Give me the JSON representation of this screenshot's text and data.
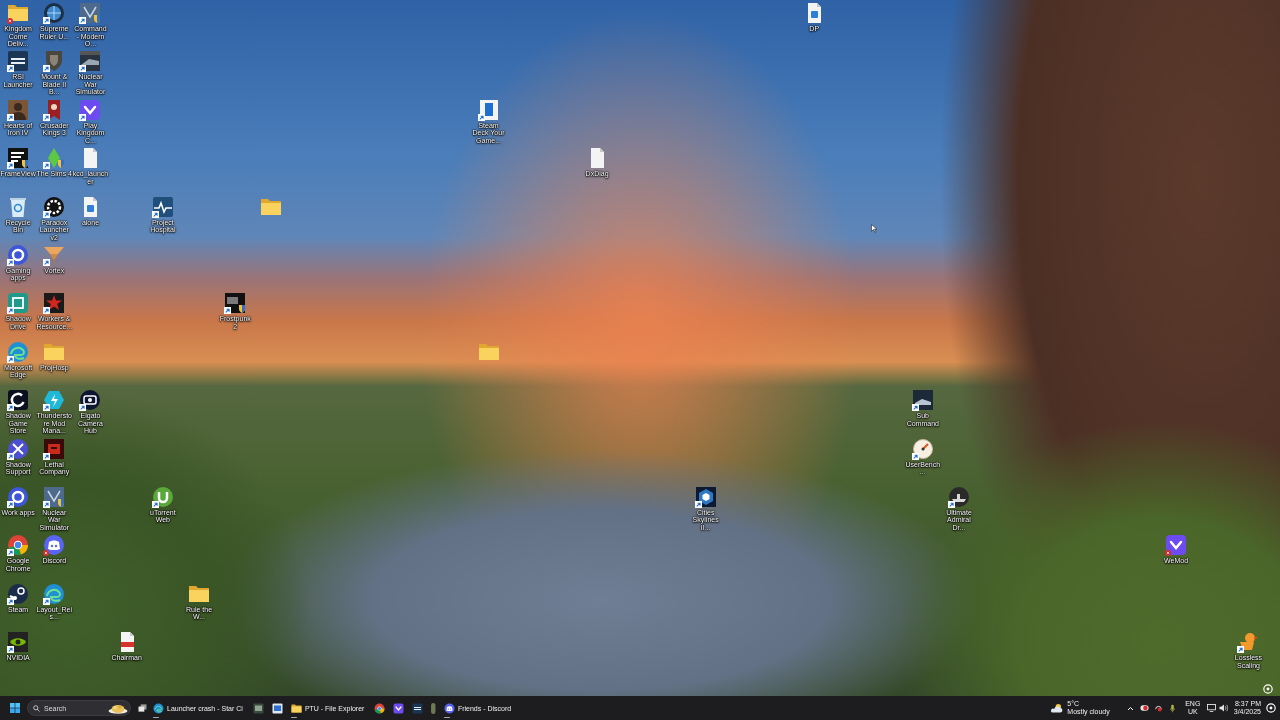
{
  "desktop": {
    "icons": [
      {
        "label": "Kingdom Come Deliv...",
        "shortcut": false,
        "alert": true
      },
      {
        "label": "RSI Launcher",
        "shortcut": true,
        "alert": false
      },
      {
        "label": "Hearts of Iron IV",
        "shortcut": true,
        "alert": false
      },
      {
        "label": "FrameView",
        "shortcut": true,
        "alert": false
      },
      {
        "label": "Recycle Bin",
        "shortcut": false,
        "alert": false
      },
      {
        "label": "Gaming apps",
        "shortcut": true,
        "alert": false
      },
      {
        "label": "Shadow Drive",
        "shortcut": true,
        "alert": false
      },
      {
        "label": "Microsoft Edge",
        "shortcut": true,
        "alert": false
      },
      {
        "label": "Shadow Game Store",
        "shortcut": true,
        "alert": false
      },
      {
        "label": "Shadow Support",
        "shortcut": true,
        "alert": false
      },
      {
        "label": "Work apps",
        "shortcut": true,
        "alert": false
      },
      {
        "label": "Google Chrome",
        "shortcut": true,
        "alert": false
      },
      {
        "label": "Steam",
        "shortcut": true,
        "alert": false
      },
      {
        "label": "NVIDIA",
        "shortcut": true,
        "alert": false
      },
      {
        "label": "Supreme Ruler U...",
        "shortcut": true,
        "alert": false
      },
      {
        "label": "Mount & Blade II B...",
        "shortcut": true,
        "alert": false
      },
      {
        "label": "Crusader Kings 3",
        "shortcut": true,
        "alert": false
      },
      {
        "label": "The Sims 4",
        "shortcut": true,
        "alert": false
      },
      {
        "label": "Paradox Launcher v2",
        "shortcut": true,
        "alert": false
      },
      {
        "label": "Vortex",
        "shortcut": true,
        "alert": false
      },
      {
        "label": "Workers & Resource...",
        "shortcut": true,
        "alert": false
      },
      {
        "label": "ProjHosp",
        "shortcut": false,
        "alert": false
      },
      {
        "label": "Thunderstore Mod Mana...",
        "shortcut": true,
        "alert": false
      },
      {
        "label": "Lethal Company",
        "shortcut": true,
        "alert": false
      },
      {
        "label": "Nuclear War Simulator",
        "shortcut": true,
        "alert": false
      },
      {
        "label": "Discord",
        "shortcut": false,
        "alert": true
      },
      {
        "label": "Layout_Reis...",
        "shortcut": true,
        "alert": false
      },
      {
        "label": "Command - Modern O...",
        "shortcut": true,
        "alert": false
      },
      {
        "label": "Nuclear War Simulator",
        "shortcut": true,
        "alert": false
      },
      {
        "label": "Play Kingdom C...",
        "shortcut": true,
        "alert": false
      },
      {
        "label": "kcd_launcher",
        "shortcut": false,
        "alert": false
      },
      {
        "label": "alone",
        "shortcut": false,
        "alert": false
      },
      {
        "label": "Elgato Camera Hub",
        "shortcut": true,
        "alert": false
      },
      {
        "label": "Chairman",
        "shortcut": false,
        "alert": false
      },
      {
        "label": "Project Hospital",
        "shortcut": true,
        "alert": false
      },
      {
        "label": "uTorrent Web",
        "shortcut": true,
        "alert": false
      },
      {
        "label": "Rule the W...",
        "shortcut": false,
        "alert": false
      },
      {
        "label": "Frostpunk 2",
        "shortcut": true,
        "alert": false
      },
      {
        "shortcut": false,
        "alert": false
      },
      {
        "label": "Steam Deck Your Game...",
        "shortcut": true,
        "alert": false
      },
      {
        "shortcut": false,
        "alert": false
      },
      {
        "label": "DxDiag",
        "shortcut": false,
        "alert": false
      },
      {
        "label": "Cities Skylines II...",
        "shortcut": true,
        "alert": false
      },
      {
        "label": "DP",
        "shortcut": false,
        "alert": false
      },
      {
        "label": "Sub Command",
        "shortcut": true,
        "alert": false
      },
      {
        "label": "UserBench...",
        "shortcut": true,
        "alert": false
      },
      {
        "label": "Ultimate Admiral Dr...",
        "shortcut": true,
        "alert": false
      },
      {
        "label": "WeMod",
        "shortcut": false,
        "alert": true
      },
      {
        "label": "Lossless Scaling",
        "shortcut": true,
        "alert": false
      }
    ]
  },
  "taskbar": {
    "search": {
      "placeholder": "Search"
    },
    "apps": [
      {
        "label": "Launcher crash - Star Ci",
        "running": true
      },
      {
        "running": false
      },
      {
        "running": false
      },
      {
        "label": "PTU - File Explorer",
        "running": true
      },
      {
        "running": false
      },
      {
        "running": false
      },
      {
        "running": false
      },
      {
        "running": false
      },
      {
        "label": "Friends - Discord",
        "running": true
      }
    ],
    "weather": {
      "temperature": "5°C",
      "condition": "Mostly cloudy"
    },
    "language": {
      "code": "ENG",
      "region": "UK"
    },
    "clock": {
      "time": "8:37 PM",
      "date": "3/4/2025"
    }
  }
}
